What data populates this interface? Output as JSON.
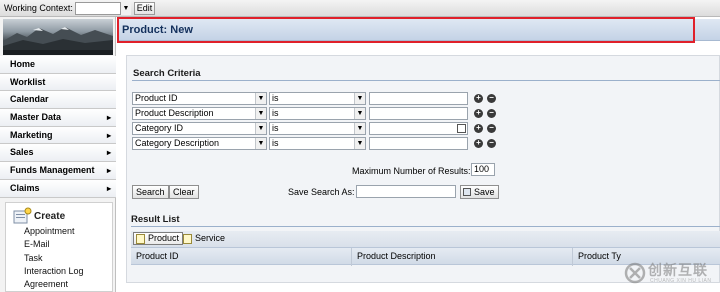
{
  "context_bar": {
    "label": "Working Context:",
    "select_value": "",
    "edit_label": "Edit"
  },
  "nav": {
    "items": [
      {
        "label": "Home",
        "has_submenu": false
      },
      {
        "label": "Worklist",
        "has_submenu": false
      },
      {
        "label": "Calendar",
        "has_submenu": false
      },
      {
        "label": "Master Data",
        "has_submenu": true
      },
      {
        "label": "Marketing",
        "has_submenu": true
      },
      {
        "label": "Sales",
        "has_submenu": true
      },
      {
        "label": "Funds Management",
        "has_submenu": true
      },
      {
        "label": "Claims",
        "has_submenu": true
      }
    ],
    "chevron": "▸"
  },
  "create": {
    "title": "Create",
    "items": [
      "Appointment",
      "E-Mail",
      "Task",
      "Interaction Log",
      "Agreement"
    ]
  },
  "page": {
    "title": "Product: New"
  },
  "search": {
    "section_title": "Search Criteria",
    "criteria": [
      {
        "field": "Product ID",
        "operator": "is",
        "value": ""
      },
      {
        "field": "Product Description",
        "operator": "is",
        "value": ""
      },
      {
        "field": "Category ID",
        "operator": "is",
        "value": ""
      },
      {
        "field": "Category Description",
        "operator": "is",
        "value": ""
      }
    ],
    "add_icon": "+",
    "remove_icon": "−",
    "max_results_label": "Maximum Number of Results:",
    "max_results_value": "100",
    "search_btn": "Search",
    "clear_btn": "Clear",
    "save_as_label": "Save Search As:",
    "save_as_value": "",
    "save_btn": "Save"
  },
  "results": {
    "section_title": "Result List",
    "tabs": [
      {
        "label": "Product",
        "selected": true
      },
      {
        "label": "Service",
        "selected": false
      }
    ],
    "columns": [
      "Product ID",
      "Product Description",
      "Product Ty"
    ]
  },
  "watermark": {
    "text": "创新互联",
    "sub": "CHUANG XIN HU LIAN"
  },
  "colors": {
    "highlight_border": "#e0202a",
    "title_text": "#13305c"
  }
}
